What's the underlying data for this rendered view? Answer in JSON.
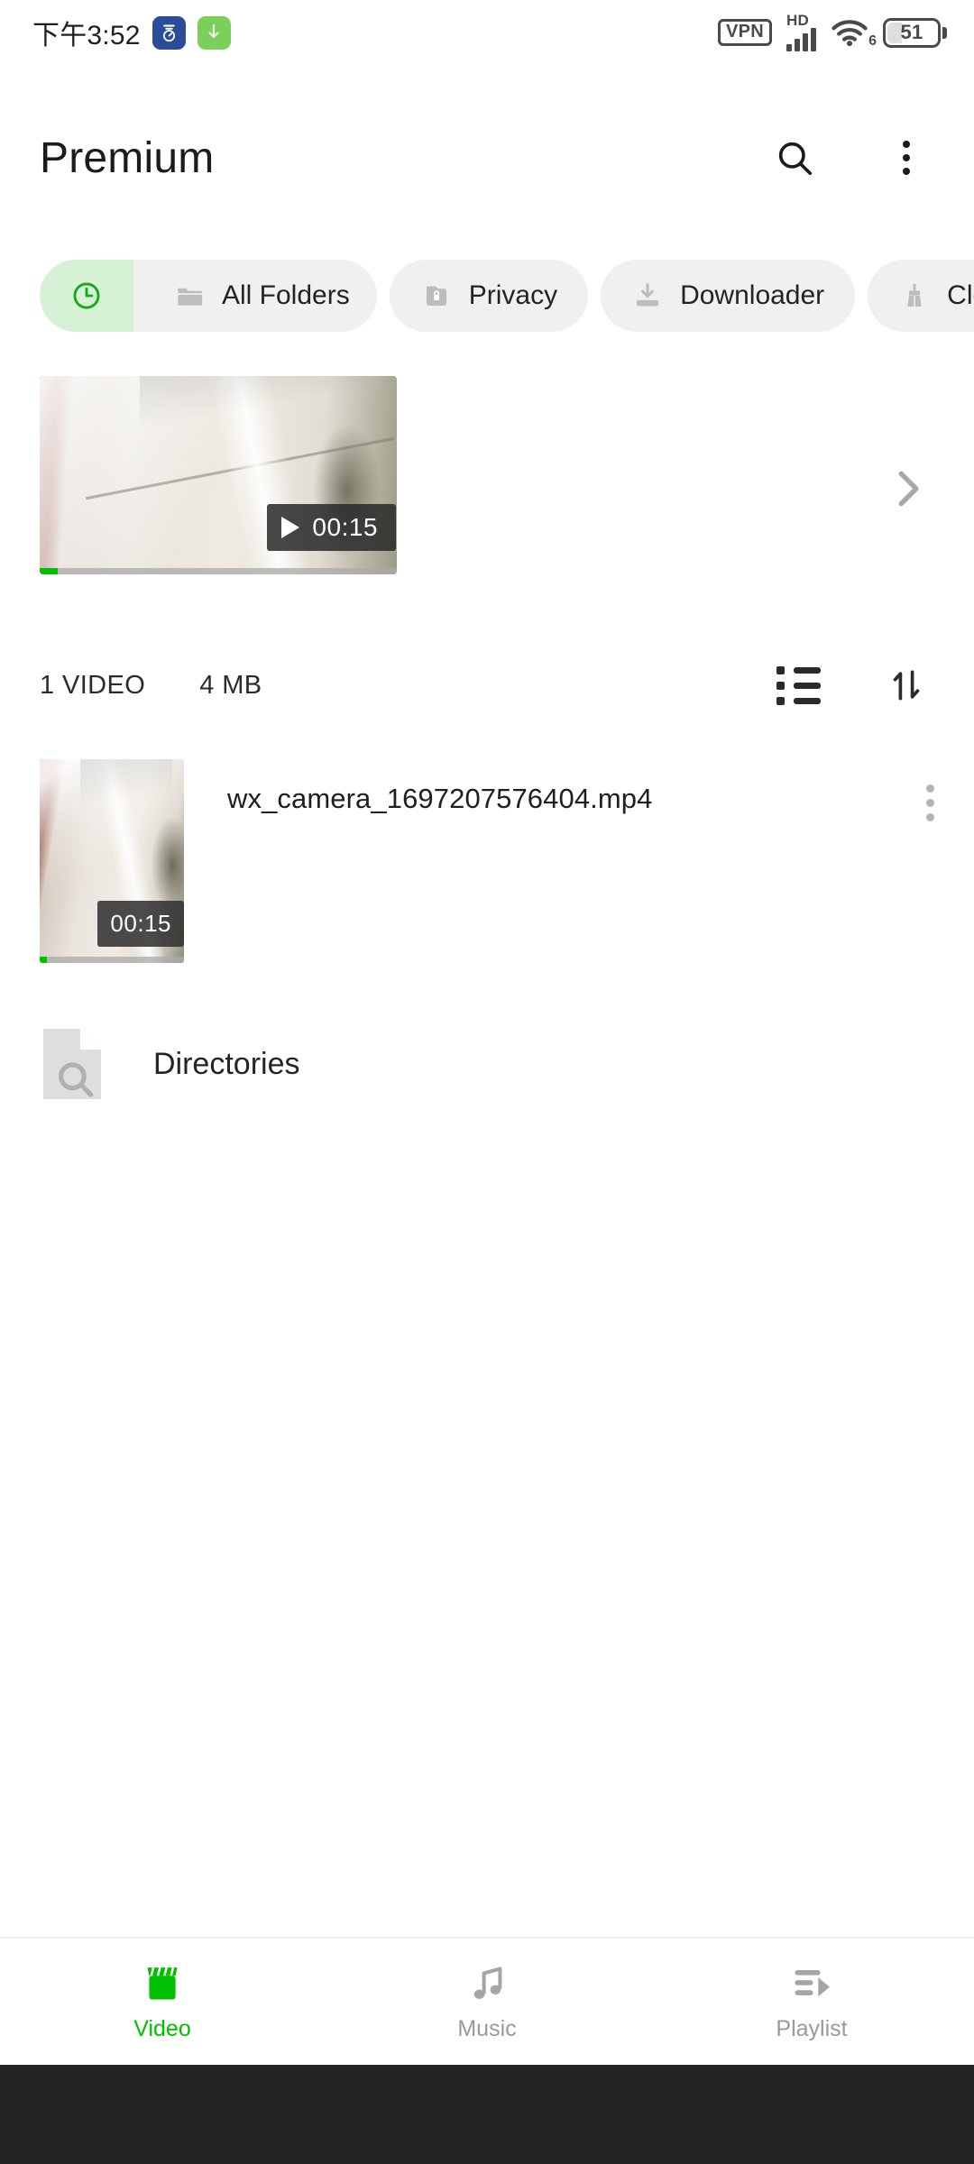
{
  "status_bar": {
    "time": "下午3:52",
    "notifications": [
      {
        "name": "speed-meter-icon",
        "color": "#2B4C9B"
      },
      {
        "name": "download-icon",
        "color": "#7BD05A"
      }
    ],
    "vpn_label": "VPN",
    "network_type": "HD",
    "signal_bars": 4,
    "wifi_generation": "6",
    "battery_percent": "51"
  },
  "app_bar": {
    "title": "Premium",
    "search_icon": "search-icon",
    "overflow_icon": "more-vertical-icon"
  },
  "chips": [
    {
      "label": "",
      "icon": "clock-icon",
      "active": true
    },
    {
      "label": "All Folders",
      "icon": "folder-icon",
      "active": false
    },
    {
      "label": "Privacy",
      "icon": "lock-folder-icon",
      "active": false
    },
    {
      "label": "Downloader",
      "icon": "download-icon",
      "active": false
    },
    {
      "label": "Clean",
      "icon": "broom-icon",
      "active": false
    }
  ],
  "hero": {
    "duration": "00:15",
    "play_icon": "play-icon",
    "chevron_icon": "chevron-right-icon",
    "progress_percent": 5
  },
  "meta": {
    "count_label": "1 VIDEO",
    "size_label": "4 MB",
    "view_icon": "list-view-icon",
    "sort_icon": "sort-icon"
  },
  "file_list": {
    "items": [
      {
        "name": "wx_camera_1697207576404.mp4",
        "duration": "00:15",
        "menu_icon": "more-vertical-icon"
      }
    ]
  },
  "directories": {
    "label": "Directories",
    "icon": "document-search-icon"
  },
  "bottom_nav": {
    "items": [
      {
        "label": "Video",
        "icon": "clapperboard-icon",
        "active": true
      },
      {
        "label": "Music",
        "icon": "music-note-icon",
        "active": false
      },
      {
        "label": "Playlist",
        "icon": "playlist-icon",
        "active": false
      }
    ]
  },
  "colors": {
    "accent_green": "#00C000",
    "chip_active_bg": "#d6f2d6",
    "chip_bg": "#f0f0f0",
    "inactive_gray": "#9a9a9a"
  }
}
